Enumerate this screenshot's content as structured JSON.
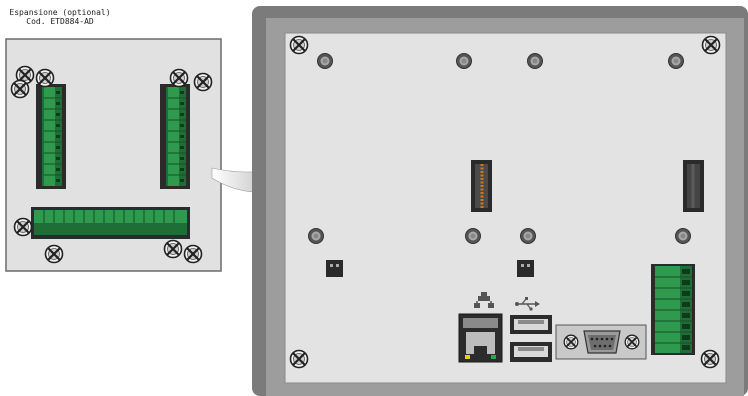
{
  "caption": {
    "line1": "Espansione (optional)",
    "line2": "Cod. ETD884-AD"
  },
  "colors": {
    "panel_frame": "#7b7b7b",
    "panel_bezel": "#9d9d9d",
    "panel_face": "#e3e3e3",
    "module_face": "#e1e1e1",
    "terminal_green": "#2d8a47",
    "connector_dark": "#2a2a2a",
    "arrow_gradient_start": "#ffffff",
    "arrow_gradient_end": "#8a8a8a"
  },
  "icons": {
    "network_port": "network-icon",
    "usb_port": "usb-icon"
  }
}
